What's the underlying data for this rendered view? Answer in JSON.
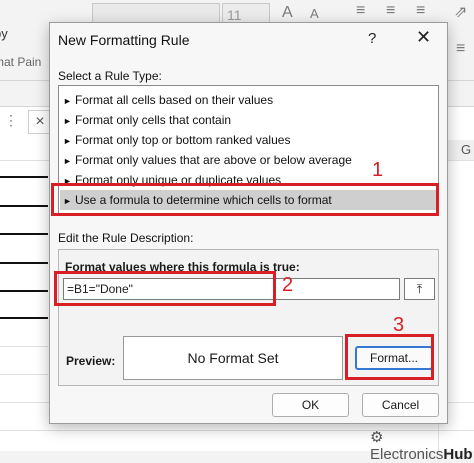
{
  "excel": {
    "font_size": "11",
    "copy_label": "py",
    "painter_label": "mat Pain",
    "column_g": "G"
  },
  "dialog": {
    "title": "New Formatting Rule",
    "help": "?",
    "close": "✕",
    "select_rule_label": "Select a Rule Type:",
    "rule_types": [
      "Format all cells based on their values",
      "Format only cells that contain",
      "Format only top or bottom ranked values",
      "Format only values that are above or below average",
      "Format only unique or duplicate values",
      "Use a formula to determine which cells to format"
    ],
    "selected_rule_index": 5,
    "edit_description_label": "Edit the Rule Description:",
    "formula_prompt": "Format values where this formula is true:",
    "formula_value": "=B1=\"Done\"",
    "ref_button": "⤒",
    "preview_label": "Preview:",
    "preview_text": "No Format Set",
    "format_button": "Format...",
    "ok_button": "OK",
    "cancel_button": "Cancel"
  },
  "annotations": {
    "step1": "1",
    "step2": "2",
    "step3": "3",
    "color": "#d81f26"
  },
  "watermark": {
    "text": "Electronics",
    "bold": "Hub"
  }
}
